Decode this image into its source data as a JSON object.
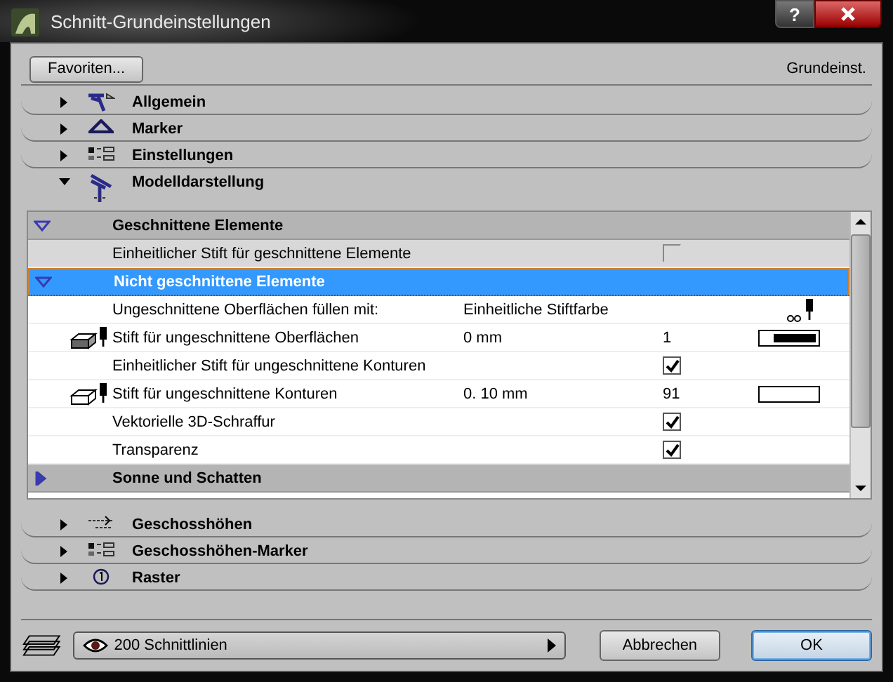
{
  "window": {
    "title": "Schnitt-Grundeinstellungen",
    "help_button": "?"
  },
  "toolbar": {
    "favorites_button": "Favoriten...",
    "preset_label": "Grundeinst."
  },
  "sections_top": [
    {
      "label": "Allgemein",
      "kind": "general",
      "expanded": false
    },
    {
      "label": "Marker",
      "kind": "marker",
      "expanded": false
    },
    {
      "label": "Einstellungen",
      "kind": "settings",
      "expanded": false
    },
    {
      "label": "Modelldarstellung",
      "kind": "model",
      "expanded": true
    }
  ],
  "model_panel": {
    "groups": [
      {
        "label": "Geschnittene Elemente",
        "expanded": true,
        "selected": false,
        "children": [
          {
            "kind": "checkbox",
            "label": "Einheitlicher Stift für geschnittene Elemente",
            "checked": false,
            "disabled": true
          }
        ]
      },
      {
        "label": "Nicht geschnittene Elemente",
        "expanded": true,
        "selected": true,
        "children": [
          {
            "kind": "option",
            "label": "Ungeschnittene Oberflächen füllen mit:",
            "value": "Einheitliche Stiftfarbe",
            "disabled": false
          },
          {
            "kind": "pen",
            "label": "Stift für ungeschnittene Oberflächen",
            "value": "0 mm",
            "number": "1",
            "color": "#000000",
            "disabled": false
          },
          {
            "kind": "checkbox",
            "label": "Einheitlicher Stift für ungeschnittene Konturen",
            "checked": true,
            "disabled": false
          },
          {
            "kind": "pen",
            "label": "Stift für ungeschnittene Konturen",
            "value": "0. 10 mm",
            "number": "91",
            "color": "#ffffff",
            "disabled": false
          },
          {
            "kind": "checkbox",
            "label": "Vektorielle 3D-Schraffur",
            "checked": true,
            "disabled": false
          },
          {
            "kind": "checkbox",
            "label": "Transparenz",
            "checked": true,
            "disabled": false
          }
        ]
      },
      {
        "label": "Sonne und Schatten",
        "expanded": false,
        "selected": false
      }
    ]
  },
  "sections_bottom": [
    {
      "label": "Geschosshöhen",
      "kind": "levels",
      "expanded": false
    },
    {
      "label": "Geschosshöhen-Marker",
      "kind": "settings",
      "expanded": false
    },
    {
      "label": "Raster",
      "kind": "grid",
      "expanded": false
    }
  ],
  "footer": {
    "layer_dropdown": "200 Schnittlinien",
    "cancel_button": "Abbrechen",
    "ok_button": "OK"
  }
}
